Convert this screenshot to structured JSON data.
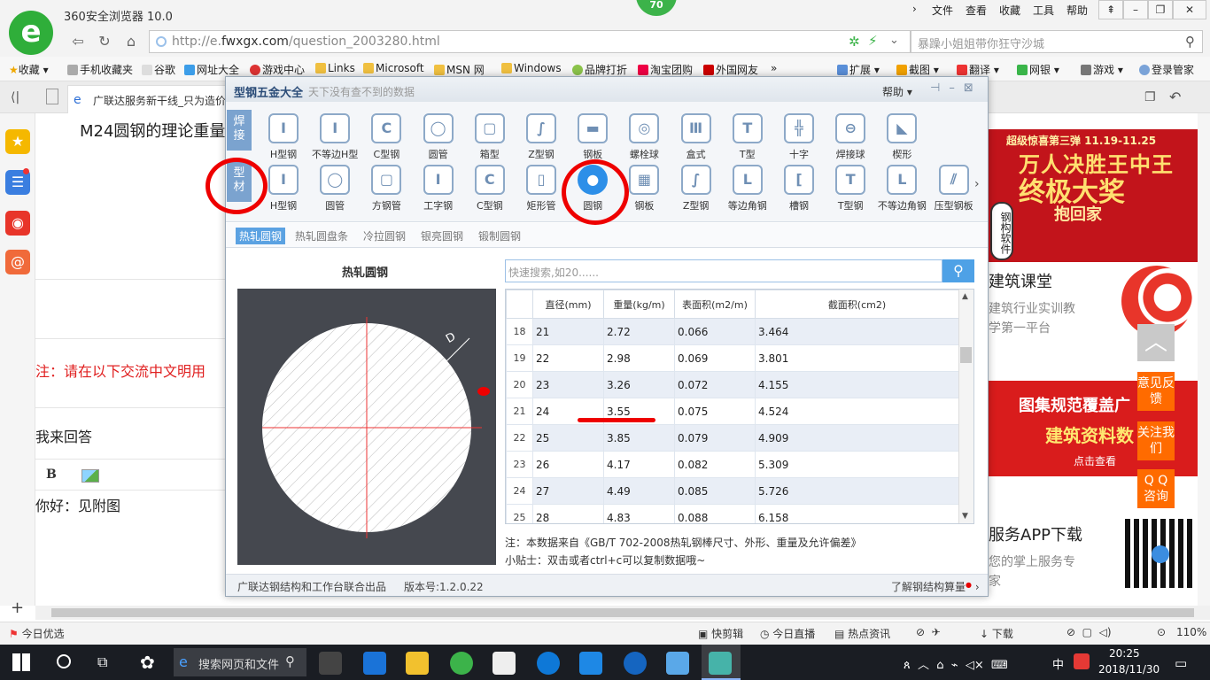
{
  "browser": {
    "title": "360安全浏览器 10.0",
    "badge": "70",
    "menu": [
      "文件",
      "查看",
      "收藏",
      "工具",
      "帮助"
    ],
    "url_prefix": "http://e.",
    "url_domain": "fwxgx.com",
    "url_path": "/question_2003280.html",
    "search_placeholder": "暴躁小姐姐带你狂守沙城",
    "bookmarks": [
      "收藏",
      "手机收藏夹",
      "谷歌",
      "网址大全",
      "游戏中心",
      "Links",
      "Microsoft",
      "MSN 网",
      "Windows",
      "品牌打折",
      "淘宝团购",
      "外国网友"
    ],
    "bm_right": [
      "扩展",
      "截图",
      "翻译",
      "网银",
      "游戏",
      "登录管家"
    ],
    "tab_label": "广联达服务新干线_只为造价"
  },
  "page": {
    "title": "M24圆钢的理论重量",
    "note": "注：请在以下交流中文明用",
    "answer_heading": "我来回答",
    "editor_bold": "B",
    "reply_text": "你好：见附图"
  },
  "ads": {
    "ad1_line1": "超级惊喜第三弹 11.19-11.25",
    "ad1_line2": "万人决胜王中王",
    "ad1_line3": "终极大奖",
    "ad1_line4": "抱回家",
    "ad1_side": "钢构软件",
    "course_title": "建筑课堂",
    "course_l1": "建筑行业实训教",
    "course_l2": "学第一平台",
    "ad3_line1": "图集规范覆盖广",
    "ad3_line2": "建筑资料数",
    "ad3_line3": "点击查看",
    "app_title": "服务APP下载",
    "app_l1": "您的掌上服务专",
    "app_l2": "家",
    "float_feedback": "意见反馈",
    "float_follow": "关注我们",
    "float_qq": "Q Q 咨询"
  },
  "popup": {
    "title": "型钢五金大全",
    "subtitle": "天下没有查不到的数据",
    "help": "帮助",
    "row1_label": "焊接",
    "row1": [
      "H型钢",
      "不等边H型",
      "C型钢",
      "圆管",
      "箱型",
      "Z型钢",
      "钢板",
      "螺栓球",
      "盒式",
      "T型",
      "十字",
      "焊接球",
      "楔形"
    ],
    "row2_label": "型材",
    "row2": [
      "H型钢",
      "圆管",
      "方钢管",
      "工字钢",
      "C型钢",
      "矩形管",
      "圆钢",
      "钢板",
      "Z型钢",
      "等边角钢",
      "槽钢",
      "T型钢",
      "不等边角钢",
      "压型钢板"
    ],
    "subtabs": [
      "热轧圆钢",
      "热轧圆盘条",
      "冷拉圆钢",
      "银亮圆钢",
      "锻制圆钢"
    ],
    "diagram_title": "热轧圆钢",
    "diagram_label": "D",
    "search_placeholder": "快速搜索,如20......",
    "table": {
      "headers": [
        "直径(mm)",
        "重量(kg/m)",
        "表面积(m2/m)",
        "截面积(cm2)"
      ],
      "rows": [
        [
          "18",
          "21",
          "2.72",
          "0.066",
          "3.464"
        ],
        [
          "19",
          "22",
          "2.98",
          "0.069",
          "3.801"
        ],
        [
          "20",
          "23",
          "3.26",
          "0.072",
          "4.155"
        ],
        [
          "21",
          "24",
          "3.55",
          "0.075",
          "4.524"
        ],
        [
          "22",
          "25",
          "3.85",
          "0.079",
          "4.909"
        ],
        [
          "23",
          "26",
          "4.17",
          "0.082",
          "5.309"
        ],
        [
          "24",
          "27",
          "4.49",
          "0.085",
          "5.726"
        ],
        [
          "25",
          "28",
          "4.83",
          "0.088",
          "6.158"
        ]
      ]
    },
    "note": "注：本数据来自《GB/T 702-2008热轧钢棒尺寸、外形、重量及允许偏差》",
    "tip": "小贴士：双击或者ctrl+c可以复制数据哦~",
    "footer_left": "广联达钢结构和工作台联合出品",
    "footer_version": "版本号:1.2.0.22",
    "footer_right": "了解钢结构算量"
  },
  "statusbar": {
    "left": "今日优选",
    "items": [
      "快剪辑",
      "今日直播",
      "热点资讯",
      "下载"
    ],
    "zoom": "110%"
  },
  "taskbar": {
    "search": "搜索网页和文件",
    "ime": "中",
    "time": "20:25",
    "date": "2018/11/30"
  },
  "colors": {
    "accent": "#2d8fe8",
    "annotation": "#e00000",
    "ad_red": "#c2141b"
  }
}
